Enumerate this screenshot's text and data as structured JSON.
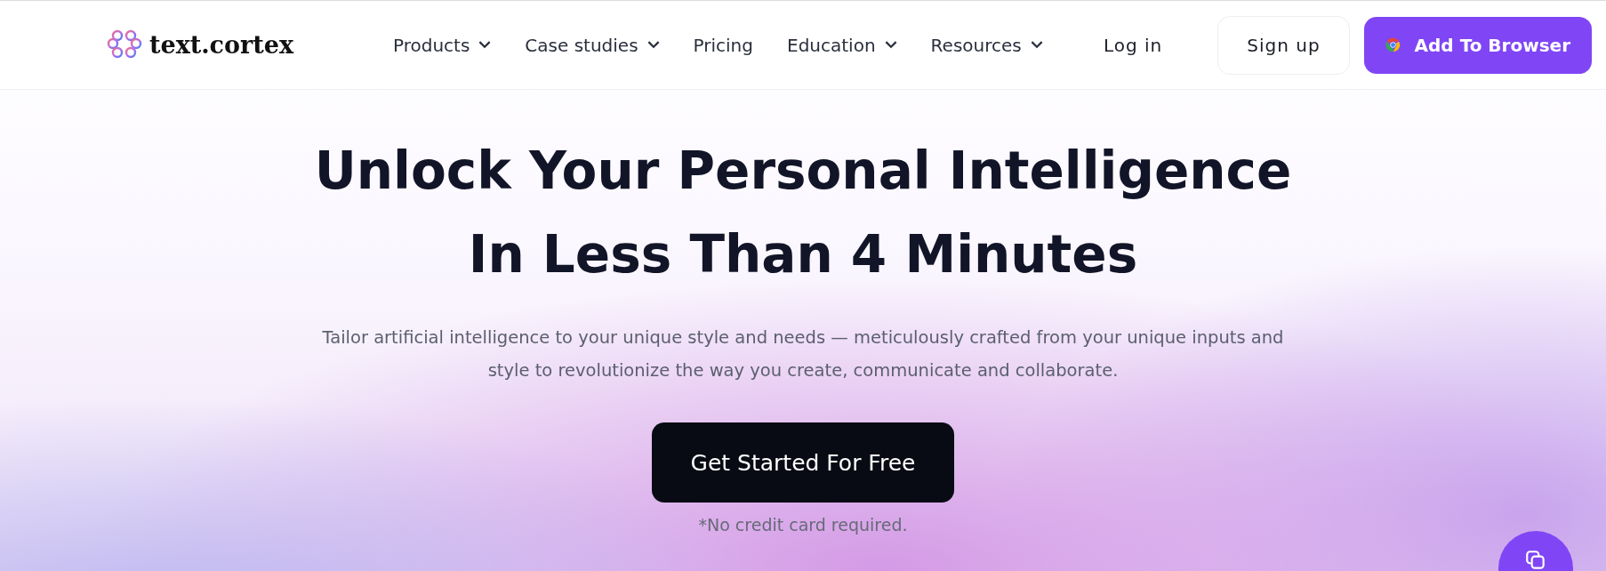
{
  "logo": {
    "text": "text.cortex"
  },
  "nav": [
    {
      "label": "Products",
      "dropdown": true
    },
    {
      "label": "Case studies",
      "dropdown": true
    },
    {
      "label": "Pricing",
      "dropdown": false
    },
    {
      "label": "Education",
      "dropdown": true
    },
    {
      "label": "Resources",
      "dropdown": true
    }
  ],
  "login": "Log in",
  "signup": "Sign up",
  "cta_browser": "Add To Browser",
  "hero": {
    "title_lines": [
      "Unlock Your Personal Intelligence",
      "In Less Than 4 Minutes"
    ],
    "subtitle_lines": [
      "Tailor artificial intelligence to your unique style and needs — meticulously crafted from your unique inputs and",
      "style to revolutionize the way you create, communicate and collaborate."
    ],
    "button": "Get Started For Free",
    "note": "*No credit card required."
  }
}
